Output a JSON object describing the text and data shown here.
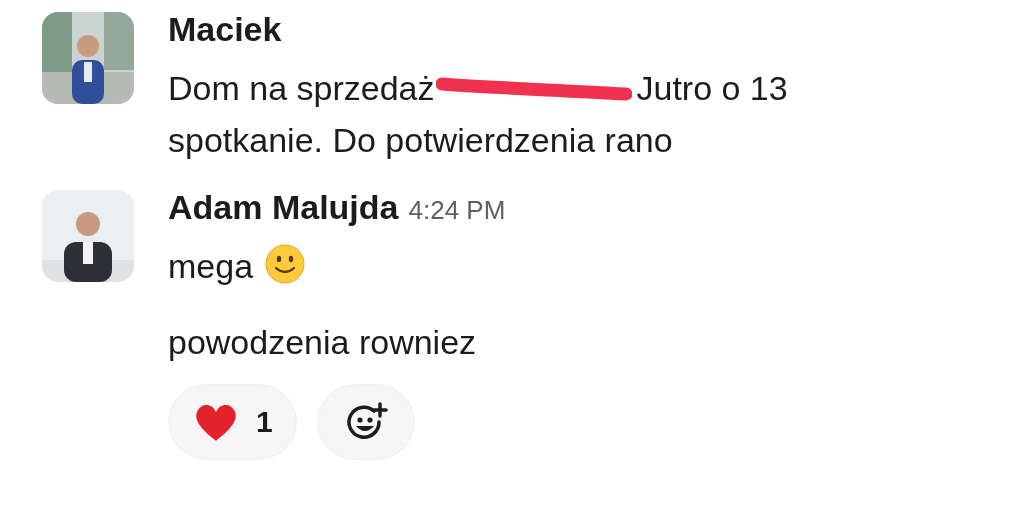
{
  "messages": [
    {
      "author": "Maciek",
      "avatar": {
        "kind": "picture"
      },
      "paragraphs": [
        [
          [
            {
              "kind": "text",
              "text": "Dom na sprzedaż"
            },
            {
              "kind": "redacted"
            },
            {
              "kind": "text",
              "text": "Jutro o 13"
            }
          ],
          [
            {
              "kind": "text",
              "text": "spotkanie. Do potwierdzenia rano"
            }
          ]
        ]
      ]
    },
    {
      "author": "Adam Malujda",
      "time": "4:24 PM",
      "avatar": {
        "kind": "picture"
      },
      "paragraphs": [
        [
          [
            {
              "kind": "text",
              "text": "mega"
            },
            {
              "kind": "emoji-smile"
            }
          ]
        ],
        [
          [
            {
              "kind": "text",
              "text": "powodzenia rowniez"
            }
          ]
        ]
      ],
      "reactions": [
        {
          "kind": "heart",
          "count": "1",
          "selected": false
        },
        {
          "kind": "add-reaction"
        }
      ]
    }
  ]
}
